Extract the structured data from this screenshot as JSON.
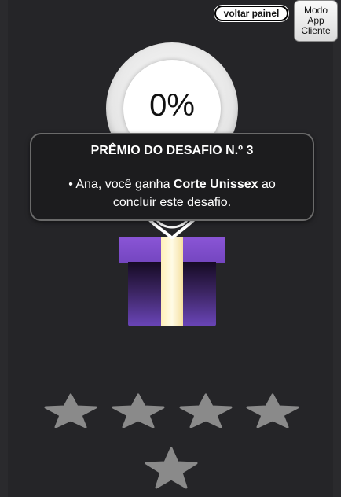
{
  "header": {
    "back_button_label": "voltar painel",
    "mode_button_label": "Modo\nApp\nCliente"
  },
  "progress": {
    "percent_label": "0%",
    "value": 0
  },
  "reward_tooltip": {
    "title": "PRÊMIO DO DESAFIO N.º 3",
    "text_prefix": "• Ana, você ganha ",
    "reward_name": "Corte Unissex",
    "text_suffix": " ao concluir este desafio."
  },
  "stars": {
    "count": 5,
    "filled": 0,
    "color": "#8a8a8a"
  },
  "colors": {
    "gift_purple": "#7446c0",
    "ribbon": "#fff0b8",
    "background": "#252528"
  }
}
